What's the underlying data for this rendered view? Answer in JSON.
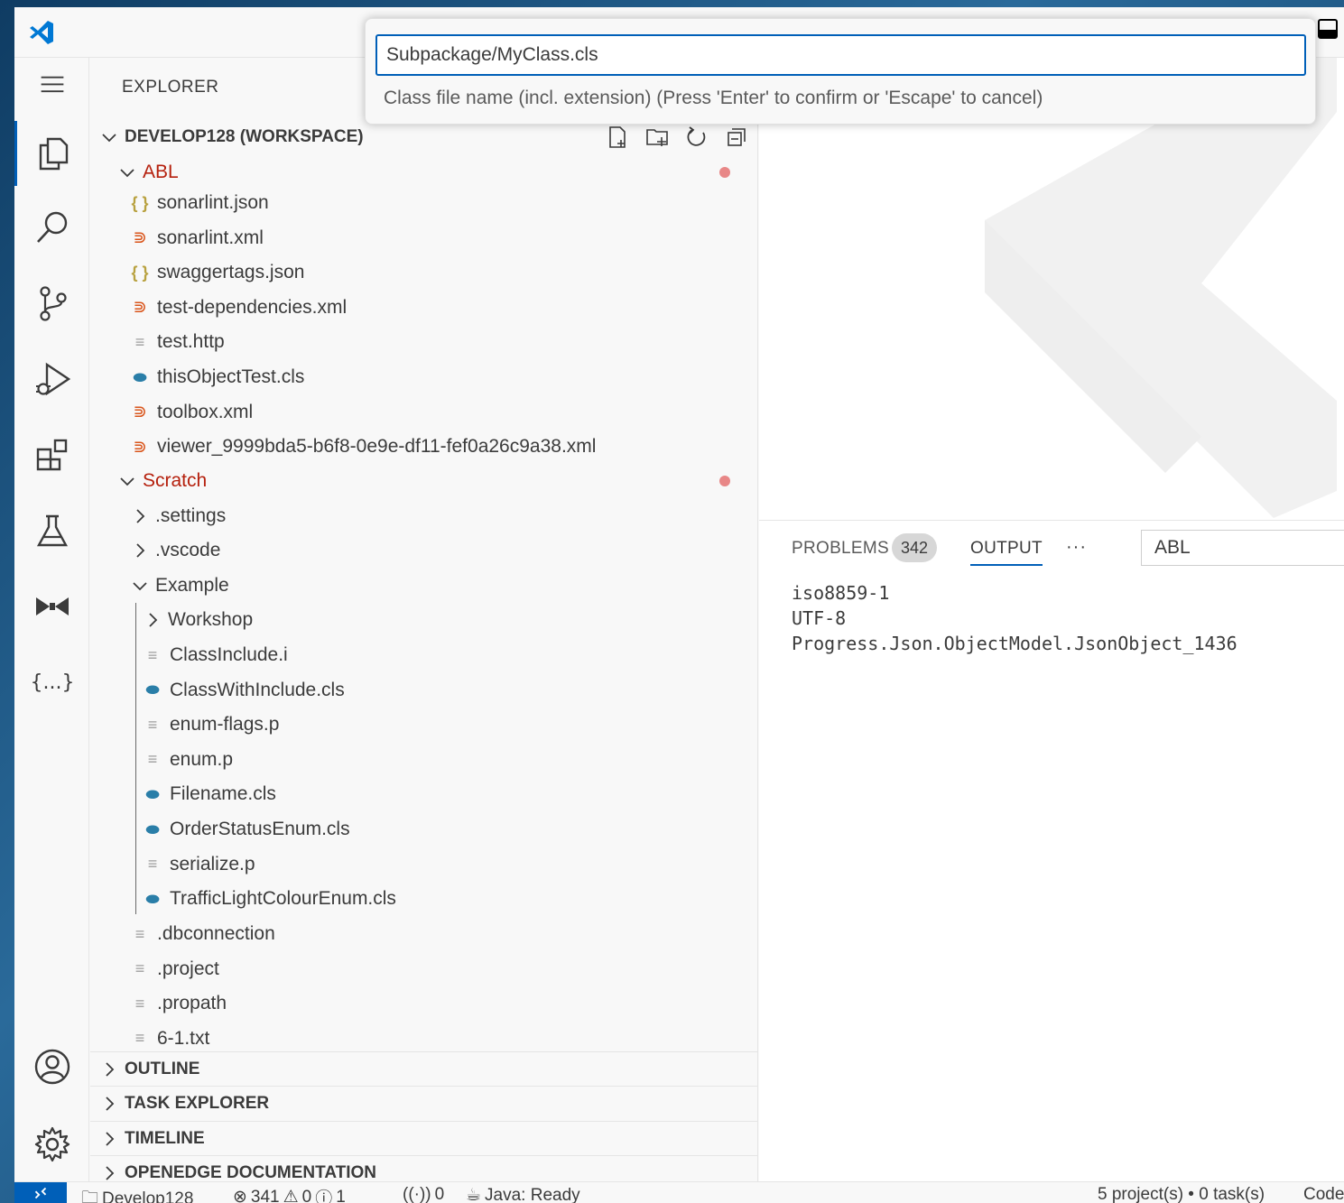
{
  "window": {
    "accent": "#005fb8"
  },
  "quick_input": {
    "value": "Subpackage/MyClass.cls",
    "message": "Class file name (incl. extension) (Press 'Enter' to confirm or 'Escape' to cancel)"
  },
  "activity_bar": {
    "items": [
      "menu-icon",
      "files-icon",
      "search-icon",
      "source-control-icon",
      "run-debug-icon",
      "extensions-icon",
      "testing-icon",
      "bowtie-icon",
      "json-braces-icon",
      "account-icon",
      "gear-icon"
    ]
  },
  "sidebar": {
    "title": "EXPLORER",
    "workspace": "DEVELOP128 (WORKSPACE)",
    "folders": {
      "abl": "ABL",
      "scratch": "Scratch"
    },
    "abl_files": [
      {
        "name": "sonarlint.json",
        "icon": "{}"
      },
      {
        "name": "sonarlint.xml",
        "icon": "rss"
      },
      {
        "name": "swaggertags.json",
        "icon": "{}"
      },
      {
        "name": "test-dependencies.xml",
        "icon": "rss"
      },
      {
        "name": "test.http",
        "icon": "≡"
      },
      {
        "name": "thisObjectTest.cls",
        "icon": "cls"
      },
      {
        "name": "toolbox.xml",
        "icon": "rss"
      },
      {
        "name": "viewer_9999bda5-b6f8-0e9e-df11-fef0a26c9a38.xml",
        "icon": "rss"
      }
    ],
    "scratch_folders": [
      ".settings",
      ".vscode"
    ],
    "example_folder": "Example",
    "example_subfolder": "Workshop",
    "example_files": [
      {
        "name": "ClassInclude.i",
        "icon": "≡"
      },
      {
        "name": "ClassWithInclude.cls",
        "icon": "cls"
      },
      {
        "name": "enum-flags.p",
        "icon": "≡"
      },
      {
        "name": "enum.p",
        "icon": "≡"
      },
      {
        "name": "Filename.cls",
        "icon": "cls"
      },
      {
        "name": "OrderStatusEnum.cls",
        "icon": "cls"
      },
      {
        "name": "serialize.p",
        "icon": "≡"
      },
      {
        "name": "TrafficLightColourEnum.cls",
        "icon": "cls"
      }
    ],
    "scratch_files": [
      ".dbconnection",
      ".project",
      ".propath",
      "6-1.txt"
    ],
    "sections": [
      "OUTLINE",
      "TASK EXPLORER",
      "TIMELINE",
      "OPENEDGE DOCUMENTATION"
    ]
  },
  "panel": {
    "tabs": {
      "problems": "PROBLEMS",
      "problems_count": "342",
      "output": "OUTPUT",
      "more": "···"
    },
    "channel": "ABL",
    "output_lines": [
      "iso8859-1",
      "UTF-8",
      "Progress.Json.ObjectModel.JsonObject_1436"
    ]
  },
  "status_bar": {
    "workspace": "Develop128",
    "errors": "341",
    "warnings": "0",
    "infos": "1",
    "ports": "0",
    "java": "Java: Ready",
    "projects": "5 project(s) • 0 task(s)",
    "code": "Code"
  }
}
